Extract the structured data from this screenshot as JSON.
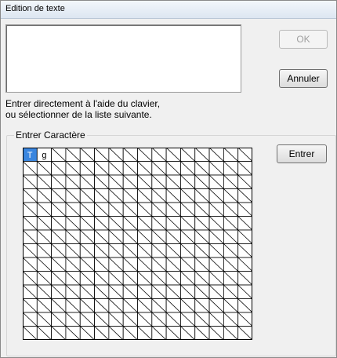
{
  "window": {
    "title": "Edition de texte"
  },
  "input": {
    "value": ""
  },
  "buttons": {
    "ok": "OK",
    "cancel": "Annuler",
    "enter": "Entrer"
  },
  "instructions": {
    "line1": "Entrer directement à l'aide du clavier,",
    "line2": "ou sélectionner de la liste suivante."
  },
  "group": {
    "label": "Entrer Caractère"
  },
  "grid": {
    "characters": [
      "T",
      "g"
    ],
    "selected": "T",
    "columns": 16,
    "rows": 14,
    "colors": {
      "selected_bg": "#3a86df",
      "selected_fg": "#ffffff",
      "line": "#000000"
    }
  }
}
